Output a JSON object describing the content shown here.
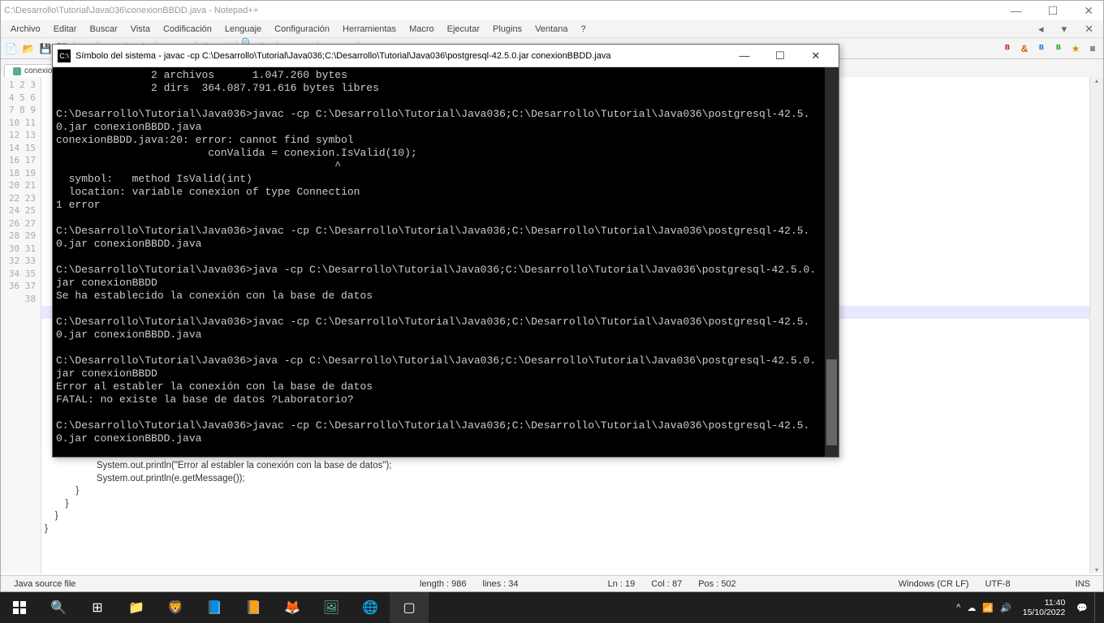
{
  "notepad": {
    "title": "C:\\Desarrollo\\Tutorial\\Java036\\conexionBBDD.java - Notepad++",
    "menu": {
      "archivo": "Archivo",
      "editar": "Editar",
      "buscar": "Buscar",
      "vista": "Vista",
      "codificacion": "Codificación",
      "lenguaje": "Lenguaje",
      "configuracion": "Configuración",
      "herramientas": "Herramientas",
      "macro": "Macro",
      "ejecutar": "Ejecutar",
      "plugins": "Plugins",
      "ventana": "Ventana",
      "help": "?"
    },
    "tab": "conexionBBDD.java",
    "code_visible_bottom": "                    System.out.println(\"Error al establer la conexión con la base de datos\");\n                    System.out.println(e.getMessage());\n            }\n        }\n    }\n}",
    "statusbar": {
      "filetype": "Java source file",
      "length": "length : 986",
      "lines": "lines : 34",
      "ln": "Ln : 19",
      "col": "Col : 87",
      "pos": "Pos : 502",
      "eol": "Windows (CR LF)",
      "encoding": "UTF-8",
      "mode": "INS"
    }
  },
  "cmd": {
    "title": "Símbolo del sistema - javac  -cp C:\\Desarrollo\\Tutorial\\Java036;C:\\Desarrollo\\Tutorial\\Java036\\postgresql-42.5.0.jar conexionBBDD.java",
    "content": "               2 archivos      1.047.260 bytes\n               2 dirs  364.087.791.616 bytes libres\n\nC:\\Desarrollo\\Tutorial\\Java036>javac -cp C:\\Desarrollo\\Tutorial\\Java036;C:\\Desarrollo\\Tutorial\\Java036\\postgresql-42.5.0.jar conexionBBDD.java\nconexionBBDD.java:20: error: cannot find symbol\n                        conValida = conexion.IsValid(10);\n                                            ^\n  symbol:   method IsValid(int)\n  location: variable conexion of type Connection\n1 error\n\nC:\\Desarrollo\\Tutorial\\Java036>javac -cp C:\\Desarrollo\\Tutorial\\Java036;C:\\Desarrollo\\Tutorial\\Java036\\postgresql-42.5.0.jar conexionBBDD.java\n\nC:\\Desarrollo\\Tutorial\\Java036>java -cp C:\\Desarrollo\\Tutorial\\Java036;C:\\Desarrollo\\Tutorial\\Java036\\postgresql-42.5.0.jar conexionBBDD\nSe ha establecido la conexión con la base de datos\n\nC:\\Desarrollo\\Tutorial\\Java036>javac -cp C:\\Desarrollo\\Tutorial\\Java036;C:\\Desarrollo\\Tutorial\\Java036\\postgresql-42.5.0.jar conexionBBDD.java\n\nC:\\Desarrollo\\Tutorial\\Java036>java -cp C:\\Desarrollo\\Tutorial\\Java036;C:\\Desarrollo\\Tutorial\\Java036\\postgresql-42.5.0.jar conexionBBDD\nError al establer la conexión con la base de datos\nFATAL: no existe la base de datos ?Laboratorio?\n\nC:\\Desarrollo\\Tutorial\\Java036>javac -cp C:\\Desarrollo\\Tutorial\\Java036;C:\\Desarrollo\\Tutorial\\Java036\\postgresql-42.5.0.jar conexionBBDD.java\n"
  },
  "taskbar": {
    "time": "11:40",
    "date": "15/10/2022",
    "tray_chevron": "^"
  },
  "toolbar_glyphs": [
    "ᴮ",
    "&",
    "ᴮ",
    "ᴮ",
    "★",
    "≡"
  ]
}
